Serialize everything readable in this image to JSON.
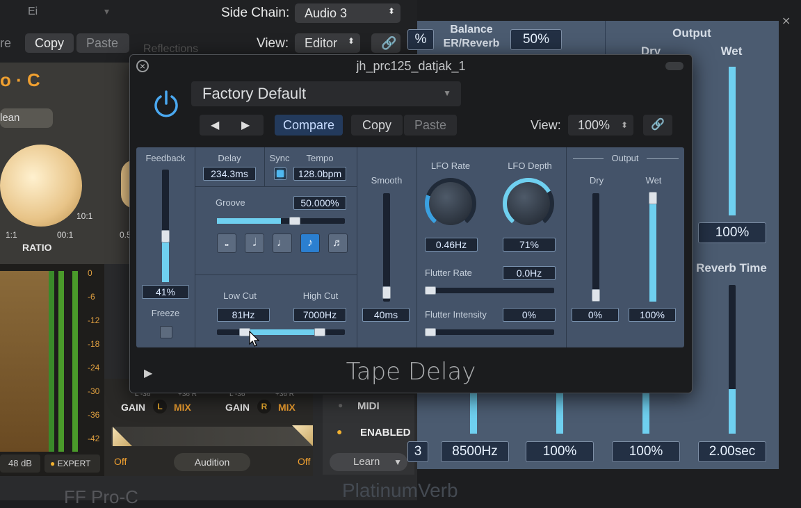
{
  "host": {
    "side_chain_label": "Side Chain:",
    "side_chain_value": "Audio 3",
    "copy_label": "Copy",
    "paste_label": "Paste",
    "view_label": "View:",
    "view_value": "Editor",
    "bg_menu_text": "Ei"
  },
  "proc": {
    "logo": "o · C",
    "mode": "lean",
    "ratio_label": "RATIO",
    "ratio_left": "1:1",
    "ratio_right": "10:1",
    "ratio_mid": "00:1",
    "second_knob_value": "0.5",
    "meter_scale": [
      "0",
      "-6",
      "-12",
      "-18",
      "-24",
      "-30",
      "-36",
      "-42"
    ],
    "gain_l": "GAIN",
    "gain_l_badge": "L",
    "mix_l": "MIX",
    "gain_r": "GAIN",
    "gain_r_badge": "R",
    "mix_r": "MIX",
    "range_l": "L -36",
    "range_l2": "+36 R",
    "range_r": "L -36",
    "range_r2": "+36 R",
    "db_value": "48 dB",
    "expert_label": "EXPERT",
    "off_left": "Off",
    "audition_label": "Audition",
    "off_right": "Off",
    "brand": "FF Pro-C",
    "midi_label": "MIDI",
    "enabled_label": "ENABLED",
    "learn_label": "Learn"
  },
  "platinum": {
    "balance_label": "Balance",
    "balance_sub": "ER/Reverb",
    "balance_value": "50%",
    "left_box_value": "%",
    "output_label": "Output",
    "dry_label": "Dry",
    "wet_label": "Wet",
    "wet_value": "100%",
    "reverb_time_label": "Reverb Time",
    "reverb_time_value": "2.00sec",
    "bottom_values": [
      "8500Hz",
      "100%",
      "100%"
    ],
    "bottom_left_fragment": "3",
    "name": "PlatinumVerb",
    "reflections_text": "Reflections"
  },
  "plugin": {
    "title": "jh_prc125_datjak_1",
    "preset": "Factory Default",
    "compare_label": "Compare",
    "copy_label": "Copy",
    "paste_label": "Paste",
    "view_label": "View:",
    "zoom_value": "100%",
    "name": "Tape Delay",
    "feedback_label": "Feedback",
    "feedback_value": "41%",
    "feedback_level": 0.41,
    "freeze_label": "Freeze",
    "delay_label": "Delay",
    "delay_value": "234.3ms",
    "sync_label": "Sync",
    "tempo_label": "Tempo",
    "tempo_value": "128.0bpm",
    "groove_label": "Groove",
    "groove_value": "50.000%",
    "groove_level": 0.5,
    "note_icons": [
      "whole-note",
      "half-note",
      "quarter-note",
      "eighth-note",
      "sixteenth-note"
    ],
    "note_glyphs": [
      "𝅝",
      "𝅗𝅥",
      "♩",
      "♪",
      "♬"
    ],
    "low_cut_label": "Low Cut",
    "low_cut_value": "81Hz",
    "high_cut_label": "High Cut",
    "high_cut_value": "7000Hz",
    "smooth_label": "Smooth",
    "smooth_value": "40ms",
    "lfo_rate_label": "LFO Rate",
    "lfo_rate_value": "0.46Hz",
    "lfo_depth_label": "LFO Depth",
    "lfo_depth_value": "71%",
    "flutter_rate_label": "Flutter Rate",
    "flutter_rate_value": "0.0Hz",
    "flutter_intensity_label": "Flutter Intensity",
    "flutter_intensity_value": "0%",
    "output_label": "Output",
    "dry_label": "Dry",
    "dry_value": "0%",
    "wet_label": "Wet",
    "wet_value": "100%",
    "accent_color": "#6fd0f0",
    "power_color": "#4aa8f0"
  }
}
